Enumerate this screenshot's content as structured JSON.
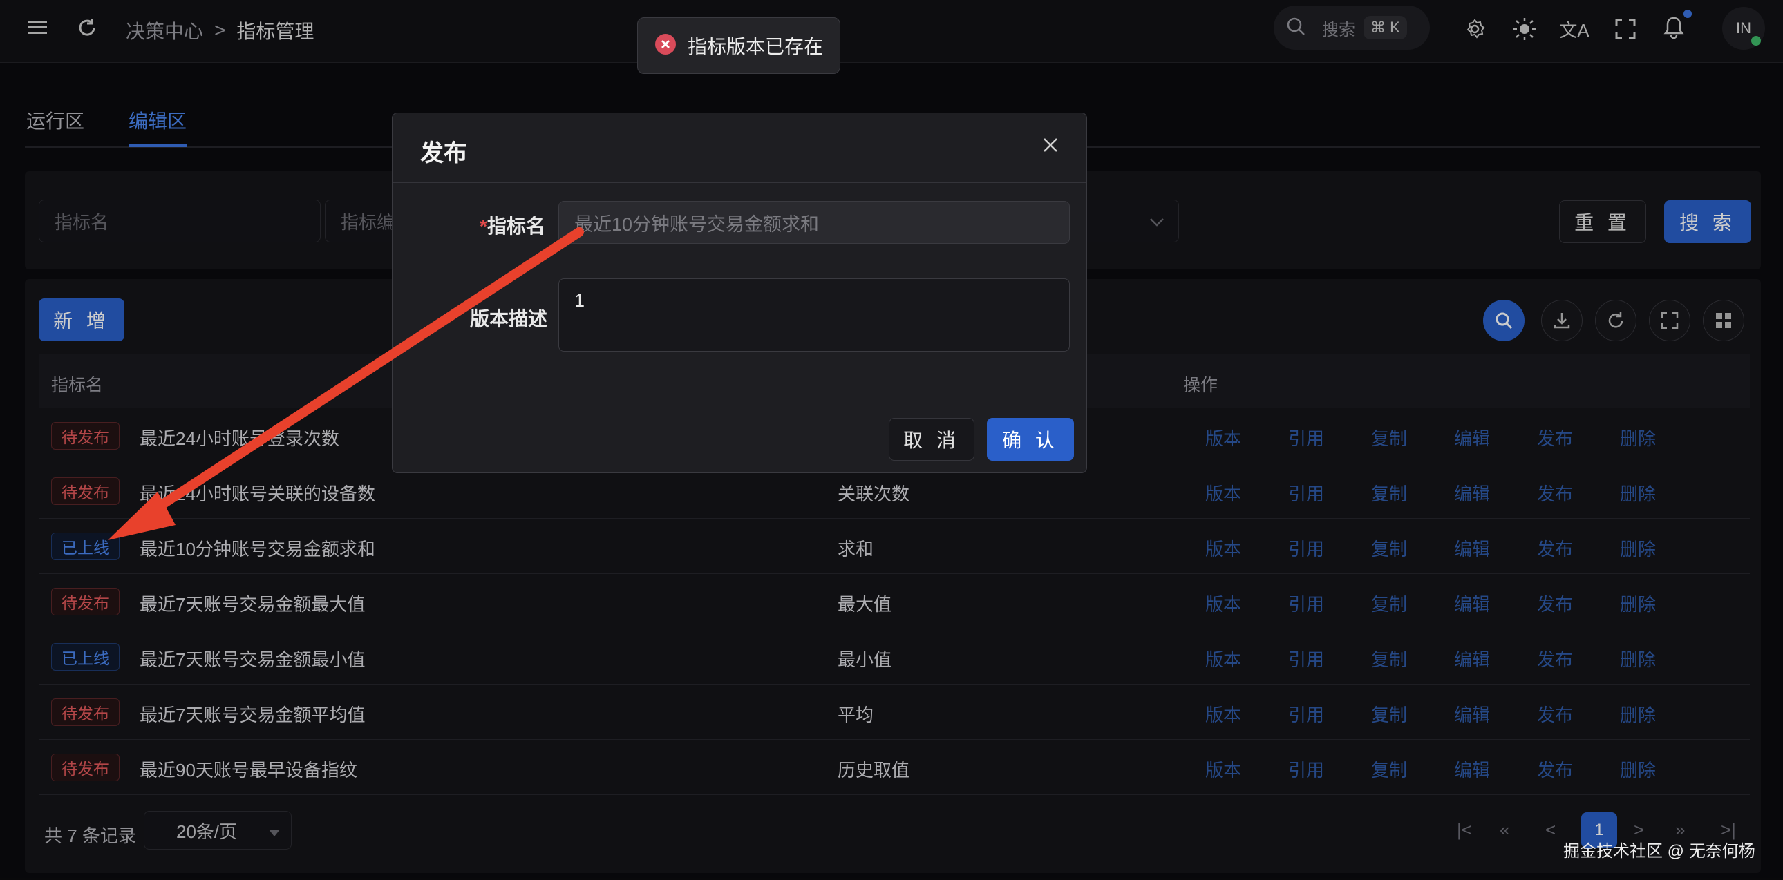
{
  "breadcrumb": {
    "root": "决策中心",
    "separator": ">",
    "current": "指标管理"
  },
  "header": {
    "search_label": "搜索",
    "search_shortcut": "⌘ K",
    "avatar_text": "IN"
  },
  "tabs": [
    {
      "label": "运行区"
    },
    {
      "label": "编辑区"
    }
  ],
  "filter": {
    "name_placeholder": "指标名",
    "code_placeholder": "指标编",
    "reset_label": "重 置",
    "search_label": "搜 索"
  },
  "toolbar": {
    "add_label": "新 增"
  },
  "table": {
    "columns": {
      "name": "指标名",
      "actions": "操作"
    },
    "action_labels": {
      "version": "版本",
      "reference": "引用",
      "copy": "复制",
      "edit": "编辑",
      "publish": "发布",
      "delete": "删除"
    },
    "rows": [
      {
        "status": "待发布",
        "status_type": "pending",
        "name": "最近24小时账号登录次数",
        "type": ""
      },
      {
        "status": "待发布",
        "status_type": "pending",
        "name": "最近24小时账号关联的设备数",
        "type": "关联次数"
      },
      {
        "status": "已上线",
        "status_type": "online",
        "name": "最近10分钟账号交易金额求和",
        "type": "求和"
      },
      {
        "status": "待发布",
        "status_type": "pending",
        "name": "最近7天账号交易金额最大值",
        "type": "最大值"
      },
      {
        "status": "已上线",
        "status_type": "online",
        "name": "最近7天账号交易金额最小值",
        "type": "最小值"
      },
      {
        "status": "待发布",
        "status_type": "pending",
        "name": "最近7天账号交易金额平均值",
        "type": "平均"
      },
      {
        "status": "待发布",
        "status_type": "pending",
        "name": "最近90天账号最早设备指纹",
        "type": "历史取值"
      }
    ]
  },
  "pagination": {
    "total_text": "共 7 条记录",
    "page_size": "20条/页",
    "current_page": "1"
  },
  "modal": {
    "title": "发布",
    "required_mark": "*",
    "name_label": "指标名",
    "name_value": "最近10分钟账号交易金额求和",
    "desc_label": "版本描述",
    "desc_value": "1",
    "cancel_label": "取 消",
    "confirm_label": "确 认"
  },
  "toast": {
    "message": "指标版本已存在"
  },
  "watermark": "掘金技术社区 @ 无奈何杨",
  "colors": {
    "accent": "#3b74e0",
    "danger": "#e0585a",
    "annotation_arrow": "#e8412c"
  }
}
